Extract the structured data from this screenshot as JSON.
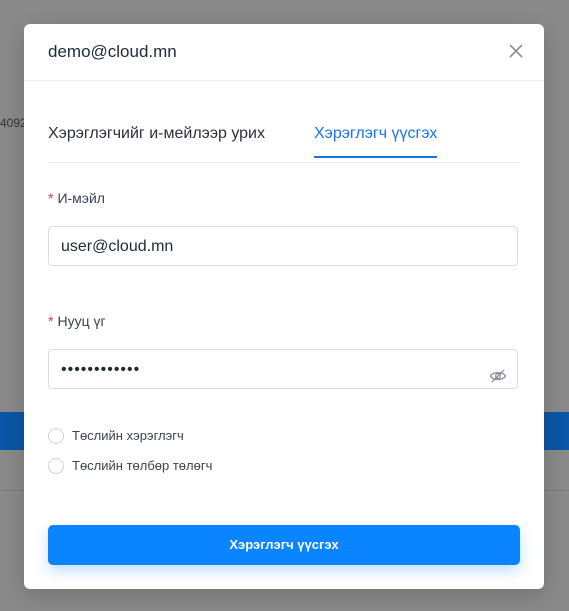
{
  "background": {
    "partial_text": "4092"
  },
  "modal": {
    "title": "demo@cloud.mn",
    "close_icon": "close-icon"
  },
  "tabs": [
    {
      "label": "Хэрэглэгчийг и-мейлээр урих",
      "active": false
    },
    {
      "label": "Хэрэглэгч үүсгэх",
      "active": true
    }
  ],
  "form": {
    "required_marker": "*",
    "email": {
      "label": "И-мэйл",
      "value": "user@cloud.mn"
    },
    "password": {
      "label": "Нууц үг",
      "value": "••••••••••••",
      "toggle_icon": "eye-off-icon"
    },
    "options": [
      {
        "label": "Төслийн хэрэглэгч",
        "checked": false
      },
      {
        "label": "Төслийн төлбөр төлөгч",
        "checked": false
      }
    ],
    "submit_label": "Хэрэглэгч үүсгэх"
  },
  "colors": {
    "accent": "#0a84ff",
    "tab_active": "#1a73e8",
    "required": "#e53935"
  }
}
